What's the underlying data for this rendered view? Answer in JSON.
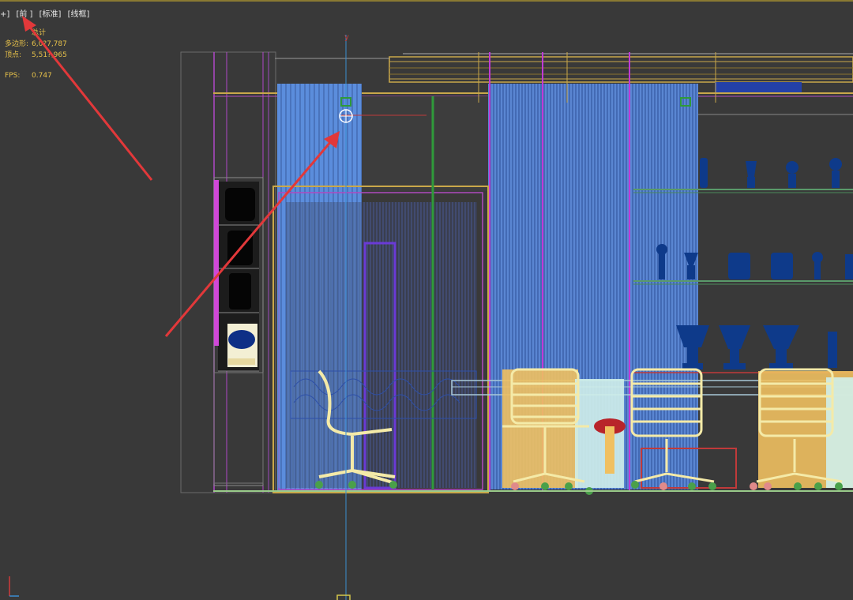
{
  "viewport_label": {
    "plus": "+]",
    "view": "[前 ]",
    "shading": "[标准]",
    "display_mode": "[线框]"
  },
  "stats": {
    "total_label": "总计",
    "polygons_label": "多边形:",
    "polygons_value": "6,0?7,787",
    "vertices_label": "顶点:",
    "vertices_value": "5,51?,965",
    "fps_label": "FPS:",
    "fps_value": "0.747"
  },
  "gizmo_axis": "y",
  "colors": {
    "background": "#393939",
    "stats_text": "#e8c24a",
    "panel_blue": "#5b8ddc",
    "wire_yellow": "#c9a84a",
    "wire_magenta": "#c03ad6",
    "wire_green": "#2f9a3a",
    "furniture_cream": "#f4eaa8",
    "furniture_gold": "#f0c060",
    "trophy_navy": "#0e3a8a",
    "annotation_red": "#e2383a"
  }
}
